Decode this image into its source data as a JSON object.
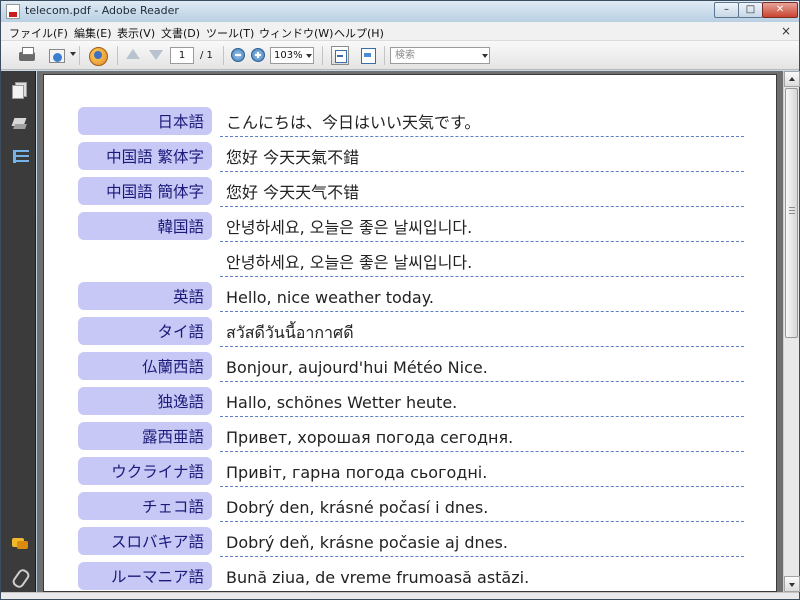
{
  "window": {
    "title": "telecom.pdf - Adobe Reader",
    "minimize_label": "–",
    "maximize_label": "□",
    "close_label": "✕"
  },
  "menu": {
    "items": [
      "ファイル(F)",
      "編集(E)",
      "表示(V)",
      "文書(D)",
      "ツール(T)",
      "ウィンドウ(W)",
      "ヘルプ(H)"
    ],
    "close_label": "×"
  },
  "toolbar": {
    "page_current": "1",
    "page_total": "/ 1",
    "zoom": "103%",
    "search_placeholder": "検索"
  },
  "icons": {
    "toolbar": [
      "printer-icon",
      "mail-icon",
      "share-icon",
      "previous-page-icon",
      "next-page-icon",
      "zoom-out-icon",
      "zoom-in-icon",
      "fit-page-icon",
      "fit-width-icon"
    ],
    "nav": [
      "pages-icon",
      "layers-icon",
      "bookmarks-icon",
      "comments-icon",
      "attachments-icon"
    ]
  },
  "colors": {
    "tag_background": "#c8c8f6",
    "tag_text": "#1a1a7a",
    "dash_line": "#5f7fc7"
  },
  "document": {
    "rows": [
      {
        "language": "日本語",
        "text": "こんにちは、今日はいい天気です。"
      },
      {
        "language": "中国語 繁体字",
        "text": "您好 今天天氣不錯"
      },
      {
        "language": "中国語 簡体字",
        "text": "您好 今天天气不错"
      },
      {
        "language": "韓国語",
        "text": "안녕하세요, 오늘은 좋은 날씨입니다."
      },
      {
        "language": "",
        "text": "안녕하세요, 오늘은 좋은 날씨입니다."
      },
      {
        "language": "英語",
        "text": "Hello, nice weather today."
      },
      {
        "language": "タイ語",
        "text": "สวัสดีวันนี้อากาศดี"
      },
      {
        "language": "仏蘭西語",
        "text": "Bonjour, aujourd'hui Météo Nice."
      },
      {
        "language": "独逸語",
        "text": "Hallo, schönes Wetter heute."
      },
      {
        "language": "露西亜語",
        "text": "Привет, хорошая погода сегодня."
      },
      {
        "language": "ウクライナ語",
        "text": "Привіт, гарна погода сьогодні."
      },
      {
        "language": "チェコ語",
        "text": "Dobrý den, krásné počasí i dnes."
      },
      {
        "language": "スロバキア語",
        "text": "Dobrý deň, krásne počasie aj dnes."
      },
      {
        "language": "ルーマニア語",
        "text": "Bună ziua, de vreme frumoasă astăzi."
      }
    ]
  }
}
